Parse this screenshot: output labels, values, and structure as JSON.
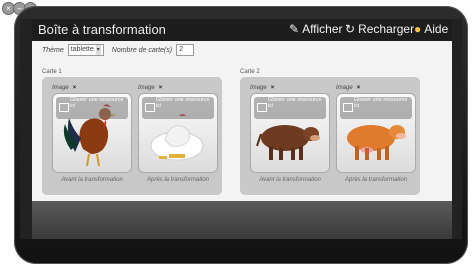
{
  "window": {
    "title": "Boîte à transformation"
  },
  "toolbar": {
    "show": "Afficher",
    "reload": "Recharger",
    "help": "Aide"
  },
  "form": {
    "theme_label": "Thème",
    "theme_value": "tablette",
    "cards_label": "Nombre de carte(s)",
    "cards_value": "2"
  },
  "cards": [
    {
      "title": "Carte 1",
      "slots": [
        {
          "label": "Image",
          "drop": "Glisser une ressource ici",
          "caption": "Avant la transformation"
        },
        {
          "label": "Image",
          "drop": "Glisser une ressource ici",
          "caption": "Après la transformation"
        }
      ]
    },
    {
      "title": "Carte 2",
      "slots": [
        {
          "label": "Image",
          "drop": "Glisser une ressource ici",
          "caption": "Avant la transformation"
        },
        {
          "label": "Image",
          "drop": "Glisser une ressource ici",
          "caption": "Après la transformation"
        }
      ]
    }
  ],
  "icons": {
    "show": "pencil-icon",
    "reload": "reload-icon",
    "help": "lightbulb-icon"
  },
  "colors": {
    "help_bulb": "#f5c04a",
    "frame": "#1a1a1a"
  }
}
